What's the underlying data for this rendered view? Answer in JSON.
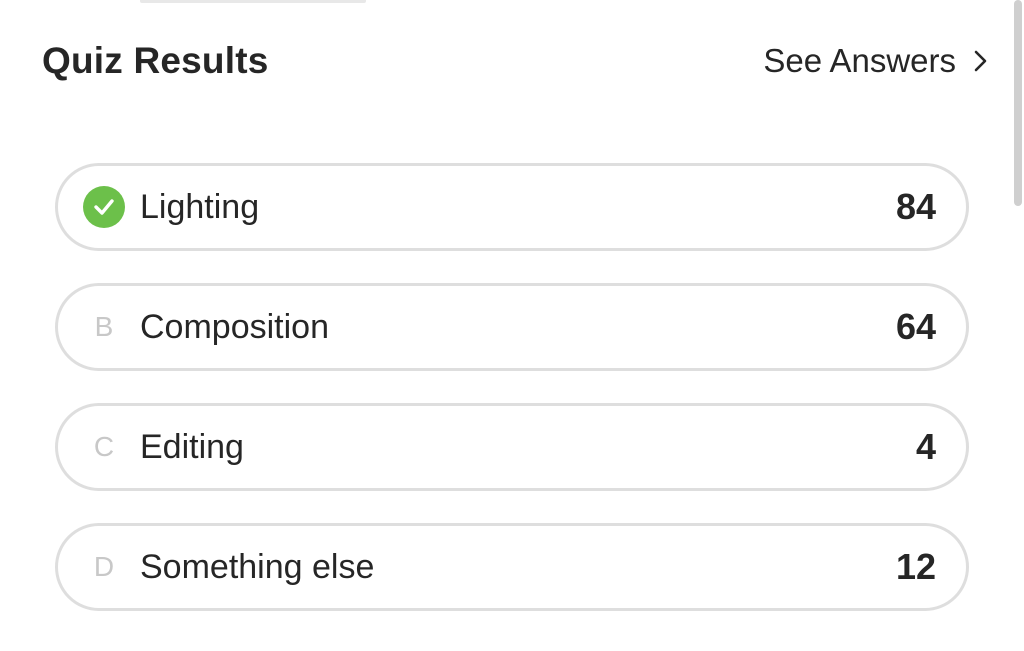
{
  "header": {
    "title": "Quiz Results",
    "see_answers_label": "See Answers",
    "see_answers_icon": "chevron-right-icon"
  },
  "options": [
    {
      "marker": "",
      "marker_icon": "check-circle-icon",
      "label": "Lighting",
      "count": "84",
      "correct": true
    },
    {
      "marker": "B",
      "label": "Composition",
      "count": "64",
      "correct": false
    },
    {
      "marker": "C",
      "label": "Editing",
      "count": "4",
      "correct": false
    },
    {
      "marker": "D",
      "label": "Something else",
      "count": "12",
      "correct": false
    }
  ],
  "colors": {
    "correct_green": "#6cc04a",
    "border": "#dedede",
    "letter_gray": "#c8c8c8",
    "text": "#262626"
  }
}
